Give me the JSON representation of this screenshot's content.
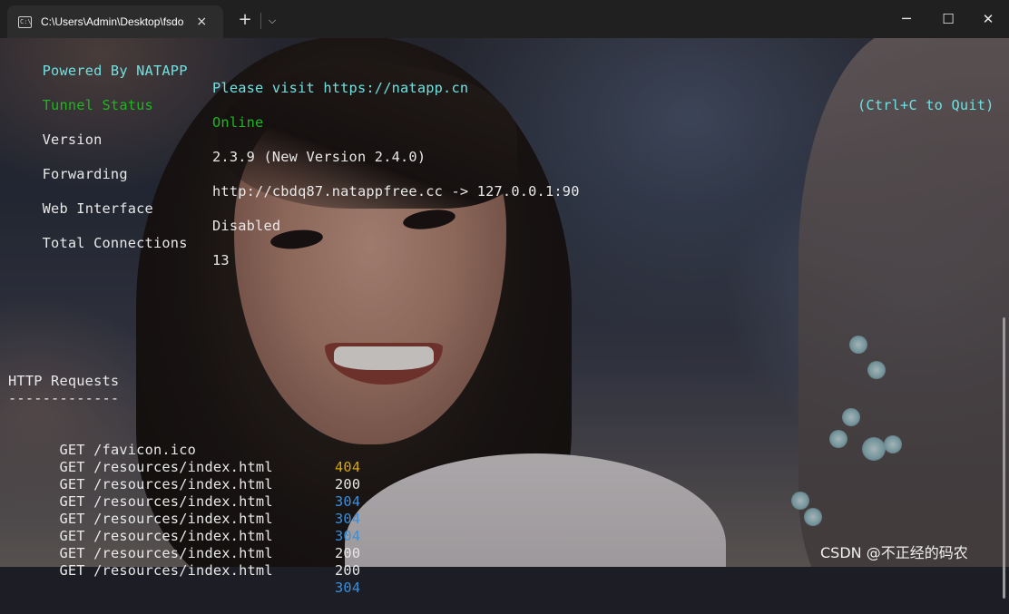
{
  "window": {
    "tab_title": "C:\\Users\\Admin\\Desktop\\fsdo",
    "tab_icon": "terminal-icon",
    "close_glyph": "×",
    "new_tab_glyph": "+",
    "dropdown_glyph": "⌵",
    "minimize_glyph": "─",
    "maximize_glyph": "☐",
    "window_close_glyph": "✕"
  },
  "status": {
    "powered_label": "Powered By NATAPP",
    "visit_text": "Please visit https://natapp.cn",
    "quit_hint": "(Ctrl+C to Quit)",
    "tunnel_label": "Tunnel Status",
    "tunnel_value": "Online",
    "version_label": "Version",
    "version_value": "2.3.9 (New Version 2.4.0)",
    "forwarding_label": "Forwarding",
    "forwarding_value": "http://cbdq87.natappfree.cc -> 127.0.0.1:90",
    "web_label": "Web Interface",
    "web_value": "Disabled",
    "connections_label": "Total Connections",
    "connections_value": "13"
  },
  "requests": {
    "heading": "HTTP Requests",
    "underline": "-------------",
    "rows": [
      {
        "method": "GET",
        "path": "/favicon.ico",
        "status": "404"
      },
      {
        "method": "GET",
        "path": "/resources/index.html",
        "status": "200"
      },
      {
        "method": "GET",
        "path": "/resources/index.html",
        "status": "304"
      },
      {
        "method": "GET",
        "path": "/resources/index.html",
        "status": "304"
      },
      {
        "method": "GET",
        "path": "/resources/index.html",
        "status": "304"
      },
      {
        "method": "GET",
        "path": "/resources/index.html",
        "status": "200"
      },
      {
        "method": "GET",
        "path": "/resources/index.html",
        "status": "200"
      },
      {
        "method": "GET",
        "path": "/resources/index.html",
        "status": "304"
      }
    ]
  },
  "colors": {
    "powered": "#6fe0e0",
    "online": "#1fb61f",
    "status_404": "#d5a80a",
    "status_304": "#3a8fdc",
    "status_200": "#e8e8e8"
  },
  "watermark": "CSDN @不正经的码农"
}
